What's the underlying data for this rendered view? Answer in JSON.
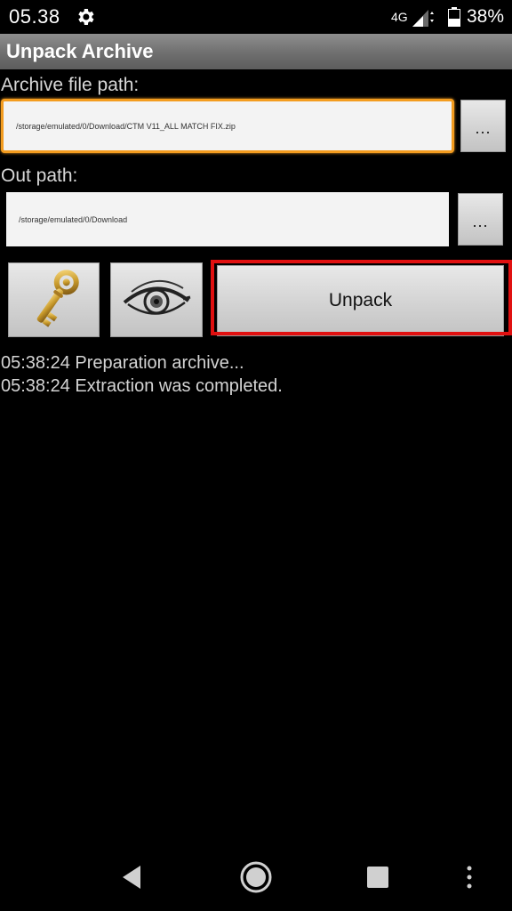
{
  "status_bar": {
    "time": "05.38",
    "network": "4G",
    "battery": "38%"
  },
  "title_bar": {
    "title": "Unpack Archive"
  },
  "archive": {
    "label": "Archive file path:",
    "value": "/storage/emulated/0/Download/CTM V11_ALL MATCH FIX.zip",
    "browse_label": "..."
  },
  "out": {
    "label": "Out path:",
    "value": "/storage/emulated/0/Download",
    "browse_label": "..."
  },
  "actions": {
    "unpack_label": "Unpack",
    "accent": "#e01010"
  },
  "log": [
    "05:38:24 Preparation archive...",
    "05:38:24 Extraction was completed."
  ],
  "icons": [
    "gear-icon",
    "signal-icon",
    "battery-icon",
    "key-icon",
    "eye-icon",
    "back-icon",
    "home-icon",
    "recents-icon",
    "more-icon"
  ]
}
